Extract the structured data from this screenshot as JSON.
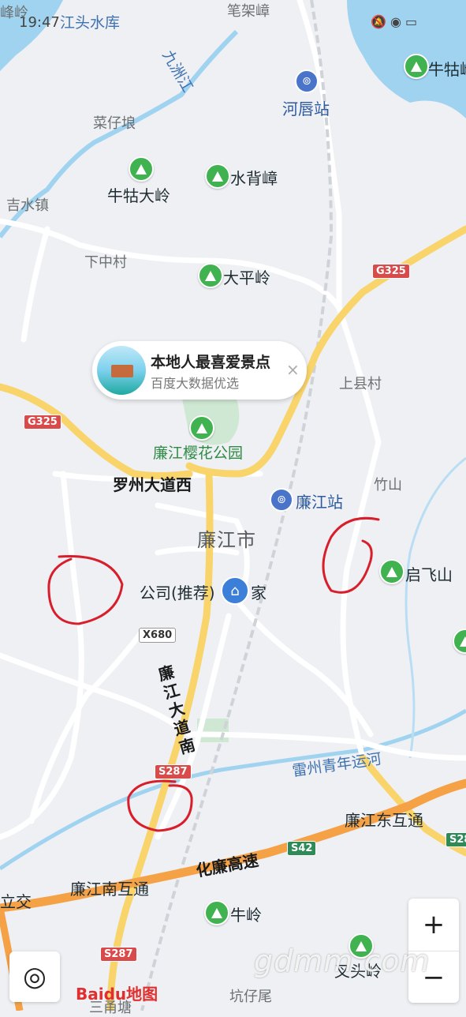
{
  "status_bar": {
    "time": "19:47"
  },
  "colors": {
    "background": "#eef0f4",
    "water": "#9fd3f0",
    "expressway": "#f5a146",
    "provincial_road": "#f9d46a",
    "minor_road": "#ffffff",
    "railway": "#cfd3d8",
    "park": "#cfe8d3",
    "annotation_circle": "#d81e2a"
  },
  "promo": {
    "title": "本地人最喜爱景点",
    "subtitle": "百度大数据优选",
    "close": "×"
  },
  "labels": {
    "fengling_top": "峰岭",
    "waishui_reservoir": "江头水库",
    "bijiazhang": "笔架嶂",
    "niu_top_right": "牛牯岭",
    "jiuzhou_river": "九洲江",
    "hechun_station": "河唇站",
    "caizailang": "菜仔埌",
    "shuibeizhang": "水背嶂",
    "niugu_daling": "牛牯大岭",
    "jishui_town": "吉水镇",
    "xiazhong_village": "下中村",
    "dapingling": "大平岭",
    "g325_top": "G325",
    "shangxian_village": "上县村",
    "g325_left": "G325",
    "park_name": "廉江樱花公园",
    "luozhou_road": "罗州大道西",
    "zhushan": "竹山",
    "lianjiang_station": "廉江站",
    "lianjiang_city": "廉江市",
    "qifeishan": "启飞山",
    "company": "公司(推荐)",
    "home": "家",
    "x680": "X680",
    "lianjiang_avenue_south": "廉江大道南",
    "s287_mid": "S287",
    "leizhou_canal": "雷州青年运河",
    "lianjiang_east_interchange": "廉江东互通",
    "s28_right": "S28",
    "s42": "S42",
    "hualian_expressway": "化廉高速",
    "lianjiang_south_interchange": "廉江南互通",
    "lijiao": "立交",
    "niuling": "牛岭",
    "s287_bottom": "S287",
    "jiantouling": "叉头岭",
    "kengzaiwei": "坑仔尾",
    "sanyongtang": "三甬塘"
  },
  "controls": {
    "zoom_in": "+",
    "zoom_out": "−",
    "locate": "◎"
  },
  "brand": {
    "logo_text": "Baidu地图"
  },
  "watermark": "gdmm.com"
}
